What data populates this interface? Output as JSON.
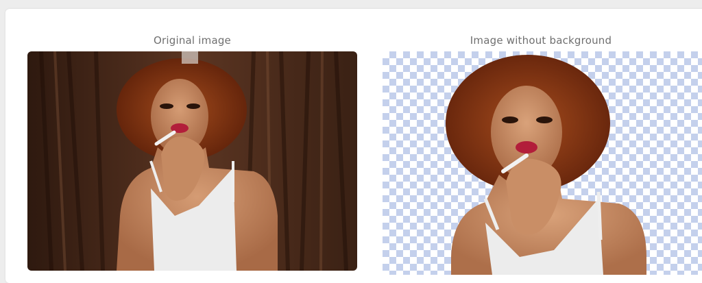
{
  "panels": {
    "original_title": "Original image",
    "result_title": "Image without background"
  },
  "colors": {
    "page_bg": "#ededed",
    "card_bg": "#ffffff",
    "caption": "#6f6f6f",
    "checker": "#c4d0ec",
    "curtain": "#4a2a1a",
    "hair": "#8a3a16",
    "skin": "#c88d66",
    "lips": "#b21e3a",
    "top": "#ececec"
  }
}
